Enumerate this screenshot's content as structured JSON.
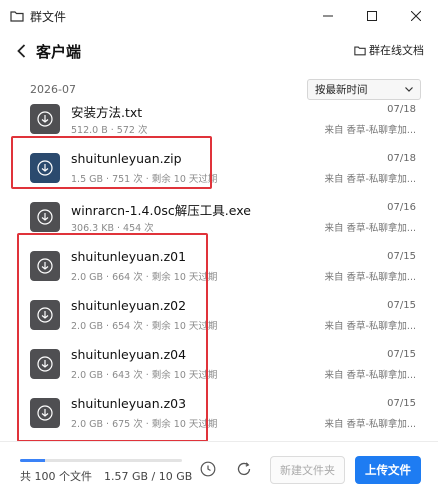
{
  "window": {
    "title": "群文件"
  },
  "header": {
    "title": "客户端",
    "online_docs": "群在线文档"
  },
  "group": {
    "date": "2026-07"
  },
  "sort": {
    "selected": "按最新时间"
  },
  "files": [
    {
      "name": "安装方法.txt",
      "meta": "512.0 B · 572 次",
      "date": "07/18",
      "source": "来自 香草-私聊拿加..."
    },
    {
      "name": "shuitunleyuan.zip",
      "meta": "1.5 GB · 751 次 · 剩余 10 天过期",
      "date": "07/18",
      "source": "来自 香草-私聊拿加..."
    },
    {
      "name": "winrarcn-1.4.0sc解压工具.exe",
      "meta": "306.3 KB · 454 次",
      "date": "07/16",
      "source": "来自 香草-私聊拿加..."
    },
    {
      "name": "shuitunleyuan.z01",
      "meta": "2.0 GB · 664 次 · 剩余 10 天过期",
      "date": "07/15",
      "source": "来自 香草-私聊拿加..."
    },
    {
      "name": "shuitunleyuan.z02",
      "meta": "2.0 GB · 654 次 · 剩余 10 天过期",
      "date": "07/15",
      "source": "来自 香草-私聊拿加..."
    },
    {
      "name": "shuitunleyuan.z04",
      "meta": "2.0 GB · 643 次 · 剩余 10 天过期",
      "date": "07/15",
      "source": "来自 香草-私聊拿加..."
    },
    {
      "name": "shuitunleyuan.z03",
      "meta": "2.0 GB · 675 次 · 剩余 10 天过期",
      "date": "07/15",
      "source": "来自 香草-私聊拿加..."
    }
  ],
  "footer": {
    "count_text": "共 100 个文件",
    "usage_text": "1.57 GB / 10 GB",
    "usage_fraction": 0.157,
    "new_folder_label": "新建文件夹",
    "upload_label": "上传文件"
  },
  "colors": {
    "accent": "#1e7cf2",
    "highlight_box": "#e0333a",
    "file_icon": "#4f4f52",
    "file_icon_selected": "#2b4a6e"
  },
  "icons": {
    "window": "folder-icon",
    "back": "chevron-left-icon",
    "online_docs": "folder-icon",
    "file": "download-icon",
    "history": "clock-icon",
    "refresh": "refresh-icon"
  }
}
